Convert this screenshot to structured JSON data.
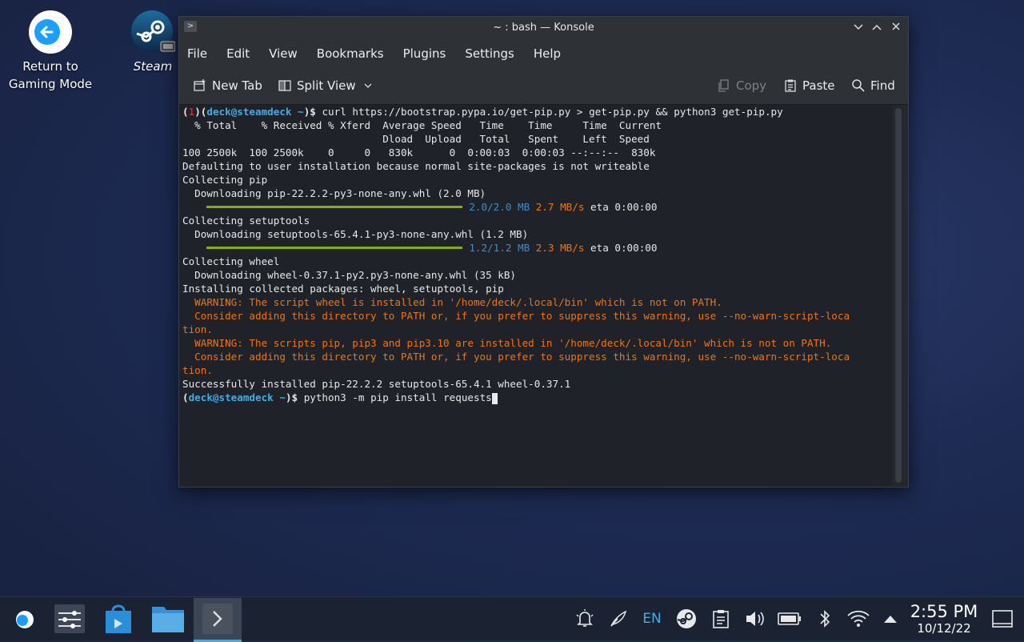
{
  "desktop": {
    "return_label_1": "Return to",
    "return_label_2": "Gaming Mode",
    "steam_label": "Steam"
  },
  "window": {
    "title": "~ : bash — Konsole",
    "menu": [
      "File",
      "Edit",
      "View",
      "Bookmarks",
      "Plugins",
      "Settings",
      "Help"
    ],
    "toolbar": {
      "new_tab": "New Tab",
      "split_view": "Split View",
      "copy": "Copy",
      "paste": "Paste",
      "find": "Find"
    }
  },
  "terminal": {
    "prompt1_exit": "1",
    "prompt_user": "deck@steamdeck",
    "prompt_dir": "~",
    "cmd1": "curl https://bootstrap.pypa.io/get-pip.py > get-pip.py && python3 get-pip.py",
    "lines_a": [
      "  % Total    % Received % Xferd  Average Speed   Time    Time     Time  Current",
      "                                 Dload  Upload   Total   Spent    Left  Speed",
      "100 2500k  100 2500k    0     0   830k      0  0:00:03  0:00:03 --:--:--  830k",
      "Defaulting to user installation because normal site-packages is not writeable",
      "Collecting pip",
      "  Downloading pip-22.2.2-py3-none-any.whl (2.0 MB)"
    ],
    "pb1": {
      "size": "2.0/2.0 MB",
      "speed": "2.7 MB/s",
      "eta": "eta 0:00:00"
    },
    "lines_b": [
      "Collecting setuptools",
      "  Downloading setuptools-65.4.1-py3-none-any.whl (1.2 MB)"
    ],
    "pb2": {
      "size": "1.2/1.2 MB",
      "speed": "2.3 MB/s",
      "eta": "eta 0:00:00"
    },
    "lines_c": [
      "Collecting wheel",
      "  Downloading wheel-0.37.1-py2.py3-none-any.whl (35 kB)",
      "Installing collected packages: wheel, setuptools, pip"
    ],
    "warnings": [
      "  WARNING: The script wheel is installed in '/home/deck/.local/bin' which is not on PATH.",
      "  Consider adding this directory to PATH or, if you prefer to suppress this warning, use --no-warn-script-loca",
      "tion.",
      "  WARNING: The scripts pip, pip3 and pip3.10 are installed in '/home/deck/.local/bin' which is not on PATH.",
      "  Consider adding this directory to PATH or, if you prefer to suppress this warning, use --no-warn-script-loca",
      "tion."
    ],
    "success": "Successfully installed pip-22.2.2 setuptools-65.4.1 wheel-0.37.1",
    "cmd2": "python3 -m pip install requests"
  },
  "taskbar": {
    "keyboard_layout": "EN",
    "time": "2:55 PM",
    "date": "10/12/22"
  }
}
